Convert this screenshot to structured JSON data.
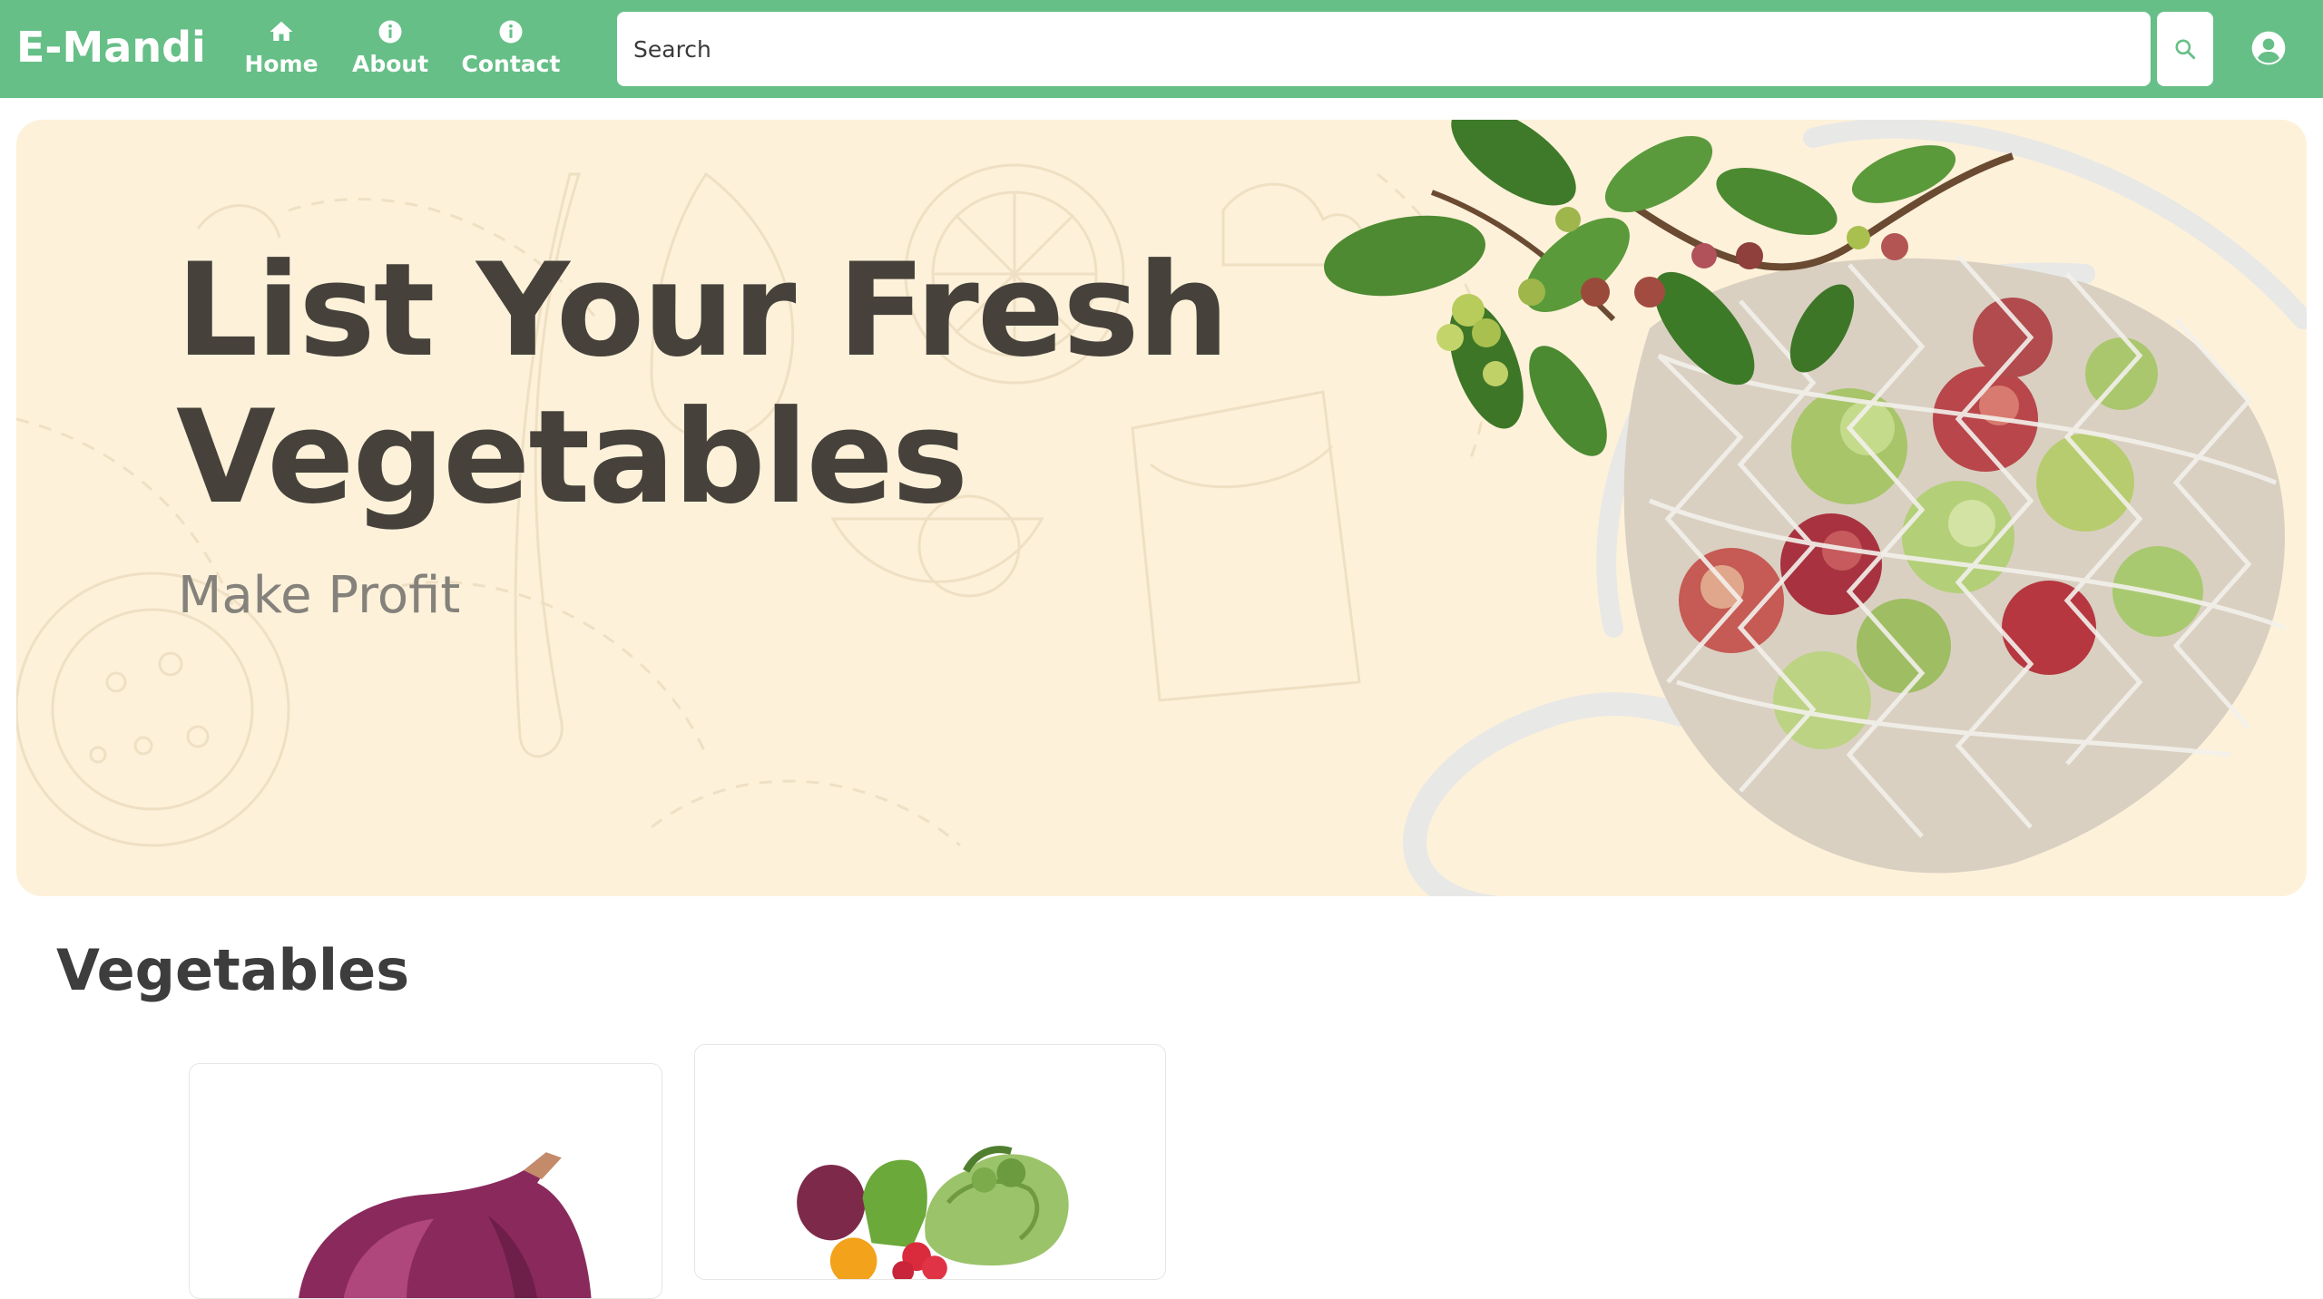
{
  "navbar": {
    "brand": "E-Mandi",
    "items": [
      {
        "label": "Home",
        "icon": "home-icon"
      },
      {
        "label": "About",
        "icon": "info-icon"
      },
      {
        "label": "Contact",
        "icon": "info-icon"
      }
    ],
    "search": {
      "placeholder": "Search",
      "value": ""
    },
    "search_button_icon": "search-icon",
    "profile_icon": "user-circle-icon"
  },
  "hero": {
    "title": "List Your Fresh Vegetables",
    "subtitle": "Make Profit"
  },
  "section": {
    "title": "Vegetables"
  },
  "products": [
    {
      "image": "red-onion"
    },
    {
      "image": "mixed-vegetables"
    }
  ],
  "colors": {
    "accent": "#66bf87",
    "hero_background": "#fdf1da",
    "heading_text": "#46423b",
    "subtitle_text": "#85817b"
  }
}
